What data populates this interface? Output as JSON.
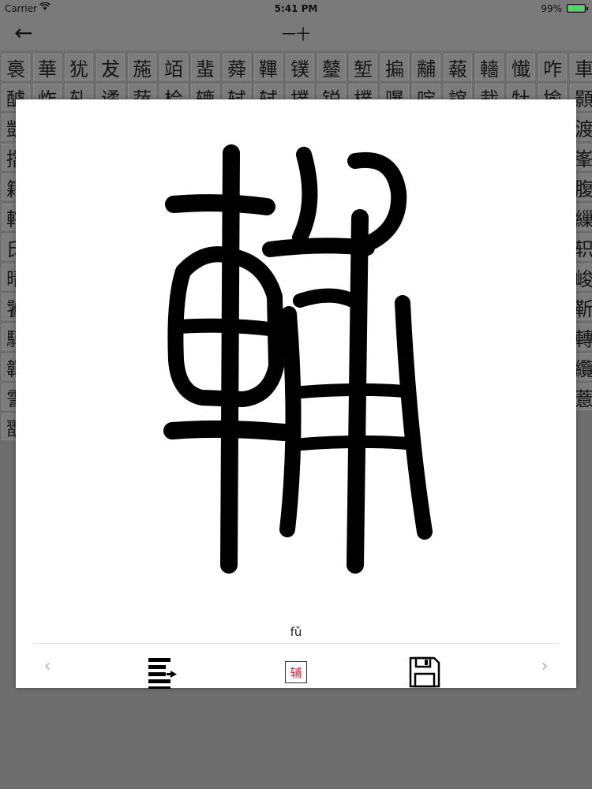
{
  "status_bar": {
    "carrier": "Carrier",
    "time": "5:41 PM",
    "battery_pct": "99%",
    "battery_level": 0.99
  },
  "nav": {
    "title": "一十"
  },
  "background_chars": [
    "裛",
    "華",
    "犹",
    "犮",
    "葹",
    "竡",
    "蜚",
    "蕣",
    "鞸",
    "镤",
    "鼞",
    "堑",
    "揙",
    "黼",
    "蕔",
    "轖",
    "懴",
    "咋",
    "車",
    "醵",
    "炸",
    "轧",
    "谲",
    "蔬",
    "检",
    "辘",
    "轼",
    "轼",
    "撲",
    "锐",
    "樸",
    "嚗",
    "啶",
    "誼",
    "蛓",
    "牡",
    "揄",
    "顥",
    "顗",
    "柏",
    "轪",
    "靜",
    "赜",
    "辐",
    "辔",
    "辍",
    "荽",
    "煻",
    "梵",
    "甿",
    "旌",
    "姑",
    "铺",
    "輆",
    "輓",
    "邢",
    "渡",
    "擋",
    "鞴",
    "轸",
    "骢",
    "騙",
    "辂",
    "骧",
    "輜",
    "豪",
    "茚",
    "糟",
    "镀",
    "镭",
    "犬",
    "渾",
    "輹",
    "賁",
    "臂",
    "峯",
    "籍",
    "輖",
    "遂",
    "轮",
    "缴",
    "钉",
    "曦",
    "啸",
    "睡",
    "睡",
    "龘",
    "讖",
    "綴",
    "粼",
    "獐",
    "鷥",
    "镰",
    "邶",
    "腹",
    "轄",
    "篲",
    "鯨",
    "煜",
    "辌",
    "錾",
    "醵",
    "甿",
    "锊",
    "鋆",
    "轐",
    "釣",
    "辛",
    "軿",
    "韜",
    "詏",
    "镞",
    "菜",
    "繅",
    "氐",
    "曈",
    "栌",
    "辇",
    "荩",
    "鬻",
    "薰",
    "逅",
    "谵",
    "崤",
    "郸",
    "鞠",
    "韦",
    "辑",
    "闢",
    "滕",
    "鞧",
    "贷",
    "轵",
    "晴",
    "镰",
    "鹑",
    "鞀",
    "蹻",
    "鎣",
    "蹕",
    "斡",
    "煩",
    "鬶",
    "騑",
    "綦",
    "麟",
    "艦",
    "辎",
    "轿",
    "斡",
    "颟",
    "峻",
    "饕",
    "蝴",
    "騮",
    "揀",
    "鱗",
    "辆",
    "钲",
    "鞠",
    "鞴",
    "軏",
    "鞲",
    "蝉",
    "旗",
    "霞",
    "膊",
    "辭",
    "籀",
    "萎",
    "靳",
    "騲",
    "穩",
    "鏢",
    "轍",
    "緹",
    "暈",
    "鬮",
    "閒",
    "曦",
    "鶉",
    "黎",
    "殷",
    "鼐",
    "鞭",
    "輳",
    "裏",
    "驪",
    "齦",
    "轉",
    "韗",
    "褘",
    "偉",
    "淖",
    "鸚",
    "章",
    "澎",
    "軫",
    "嫜",
    "偉",
    "翮",
    "責",
    "软",
    "犀",
    "準",
    "慄",
    "韓",
    "偉",
    "纜",
    "霅",
    "真",
    "黇",
    "槵",
    "頛",
    "軫",
    "軴",
    "膊",
    "直",
    "辇",
    "軩",
    "蟄",
    "铜",
    "轫",
    "軸",
    "蠼",
    "韓",
    "薏",
    "薏",
    "飁",
    "顫",
    "軎",
    "鬚",
    "輟",
    "輻",
    "鸛"
  ],
  "modal": {
    "glyph_char": "輔",
    "pinyin": "fǔ",
    "stamp_char": "辅"
  }
}
